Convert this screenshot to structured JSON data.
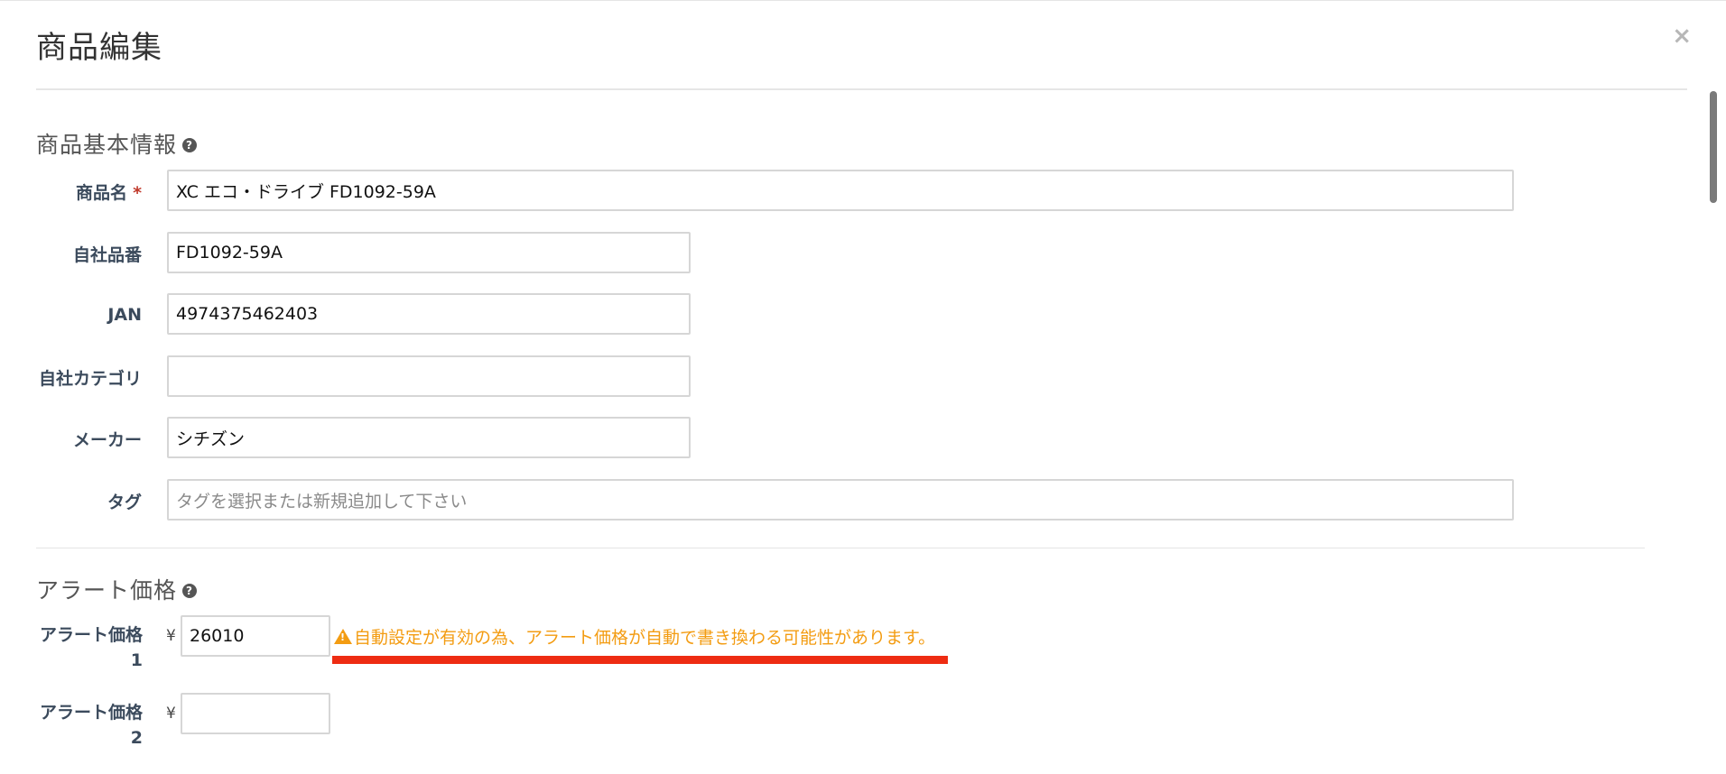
{
  "modal": {
    "title": "商品編集",
    "close_label": "×"
  },
  "basic_section": {
    "title": "商品基本情報",
    "help_icon": "?",
    "fields": {
      "product_name": {
        "label": "商品名",
        "required_mark": "*",
        "value": "XC エコ・ドライブ FD1092-59A"
      },
      "sku": {
        "label": "自社品番",
        "value": "FD1092-59A"
      },
      "jan": {
        "label": "JAN",
        "value": "4974375462403"
      },
      "category": {
        "label": "自社カテゴリ",
        "value": ""
      },
      "maker": {
        "label": "メーカー",
        "value": "シチズン"
      },
      "tags": {
        "label": "タグ",
        "value": "",
        "placeholder": "タグを選択または新規追加して下さい"
      }
    }
  },
  "alert_section": {
    "title": "アラート価格",
    "help_icon": "?",
    "currency": "¥",
    "price1": {
      "label_line1": "アラート価格",
      "label_line2": "1",
      "value": "26010"
    },
    "price2": {
      "label_line1": "アラート価格",
      "label_line2": "2",
      "value": ""
    },
    "warning_icon": "warning-icon",
    "warning_text": "自動設定が有効の為、アラート価格が自動で書き換わる可能性があります。"
  },
  "colors": {
    "warning": "#f39c12",
    "highlight": "#ee2c12",
    "required": "#c0392b"
  }
}
